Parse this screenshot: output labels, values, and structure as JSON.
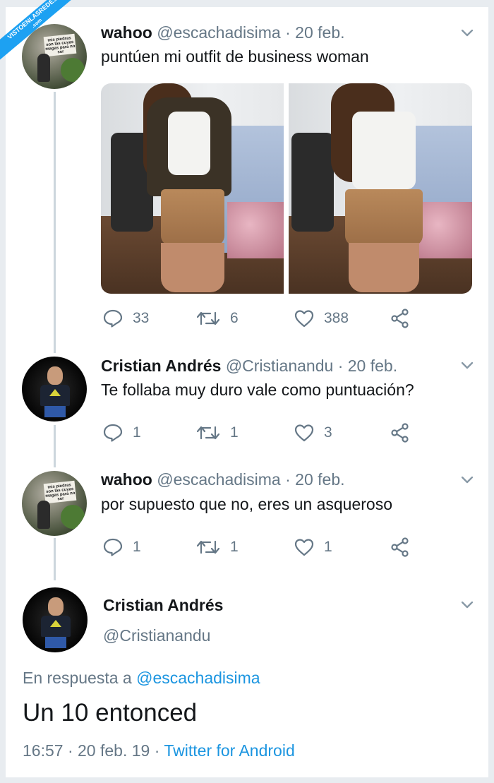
{
  "watermark": {
    "text": "VISTOENLASREDES",
    "sub": ".com"
  },
  "tweets": [
    {
      "name": "wahoo",
      "handle": "@escachadisima",
      "separator": "·",
      "date": "20 feb.",
      "text": "puntúen mi outfit de business woman",
      "avatar_sign_text": "mis piedras son las cuyas magas para no ser",
      "replies": "33",
      "retweets": "6",
      "likes": "388"
    },
    {
      "name": "Cristian Andrés",
      "handle": "@Cristianandu",
      "separator": "·",
      "date": "20 feb.",
      "text": "Te follaba muy duro vale como puntuación?",
      "replies": "1",
      "retweets": "1",
      "likes": "3"
    },
    {
      "name": "wahoo",
      "handle": "@escachadisima",
      "separator": "·",
      "date": "20 feb.",
      "text": "por supuesto que no, eres un asqueroso",
      "replies": "1",
      "retweets": "1",
      "likes": "1"
    }
  ],
  "main_tweet": {
    "name": "Cristian Andrés",
    "handle": "@Cristianandu",
    "reply_prefix": "En respuesta a",
    "reply_to": "@escachadisima",
    "text": "Un 10 entonced",
    "time": "16:57",
    "separator": "·",
    "date": "20 feb. 19",
    "separator2": "·",
    "client": "Twitter for Android"
  },
  "colors": {
    "text": "#14171a",
    "secondary": "#657786",
    "link": "#1b95e0",
    "thread_line": "#ccd6dd"
  },
  "icons": [
    "reply-icon",
    "retweet-icon",
    "like-icon",
    "share-icon",
    "chevron-down-icon"
  ]
}
